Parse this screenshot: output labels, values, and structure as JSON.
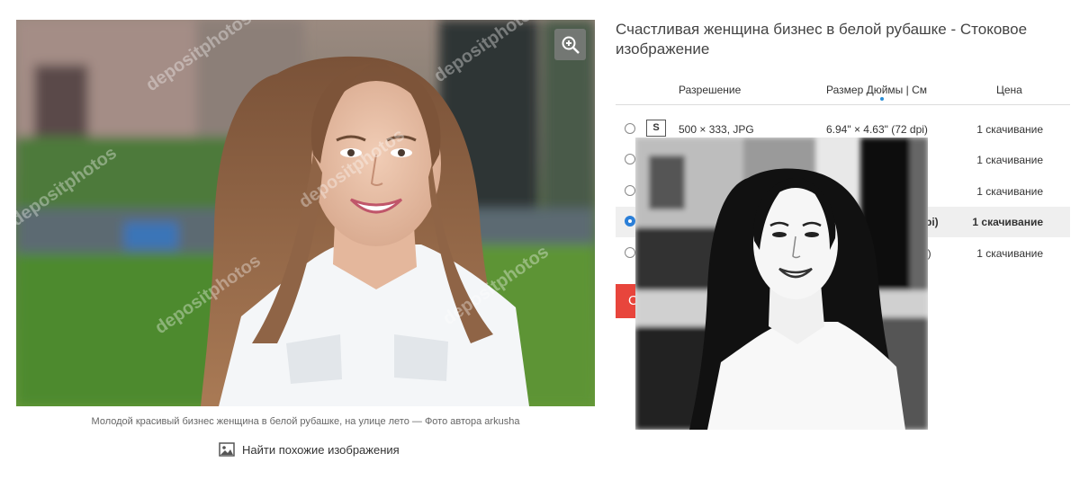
{
  "image": {
    "watermark": "depositphotos",
    "caption": "Молодой красивый бизнес женщина в белой рубашке, на улице лето — Фото автора arkusha",
    "find_similar": "Найти похожие изображения",
    "icons": {
      "zoom": "zoom-in-icon",
      "similar": "image-icon"
    }
  },
  "panel": {
    "title": "Счастливая женщина бизнес в белой рубашке  -  Стоковое изображение",
    "headers": {
      "resolution": "Разрешение",
      "size": "Размер Дюймы | См",
      "price": "Цена"
    },
    "rows": [
      {
        "badge": "S",
        "resolution": "500 × 333, JPG",
        "size": "6.94\" × 4.63\" (72 dpi)",
        "price": "1 скачивание",
        "selected": false
      },
      {
        "badge": "",
        "resolution": "",
        "size": "",
        "price": "1 скачивание",
        "selected": false
      },
      {
        "badge": "",
        "resolution": "",
        "size": "",
        "price": "1 скачивание",
        "selected": false
      },
      {
        "badge": "",
        "resolution": "",
        "size": "pi)",
        "price": "1 скачивание",
        "selected": true
      },
      {
        "badge": "",
        "resolution": "",
        "size": "i)",
        "price": "1 скачивание",
        "selected": false
      }
    ],
    "download_button": "С"
  },
  "colors": {
    "accent": "#e8453c",
    "radio": "#2b7fd8"
  }
}
